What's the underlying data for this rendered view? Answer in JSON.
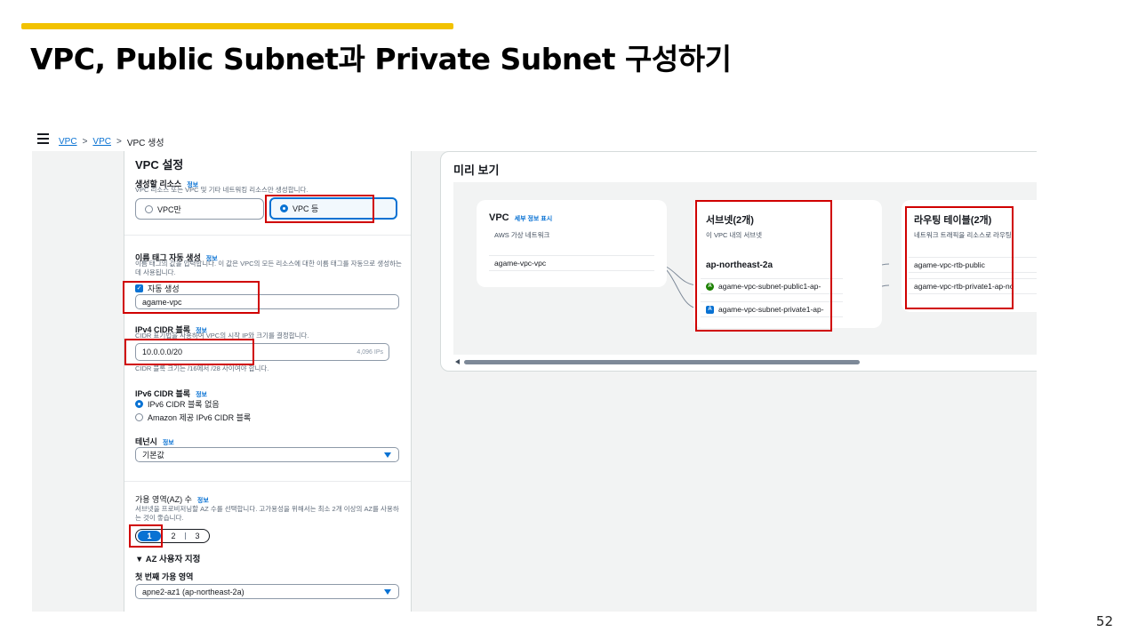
{
  "slide": {
    "title": "VPC, Public Subnet과 Private Subnet 구성하기",
    "page_number": "52",
    "accent_color": "#f2c200"
  },
  "console": {
    "breadcrumb": [
      "VPC",
      "VPC",
      "VPC 생성"
    ],
    "vpc_settings": {
      "heading": "VPC 설정",
      "resources_label": "생성할 리소스",
      "info": "정보",
      "resources_desc": "VPC 리소스 또는 VPC 및 기타 네트워킹 리소스만 생성합니다.",
      "option_vpc_only": "VPC만",
      "option_vpc_more": "VPC 등",
      "selected_option": "VPC 등"
    },
    "name_tag": {
      "label": "이름 태그 자동 생성",
      "info": "정보",
      "desc": "이름 태그의 값을 입력합니다. 이 값은 VPC의 모든 리소스에 대한 이름 태그를 자동으로 생성하는 데 사용됩니다.",
      "auto_generate_label": "자동 생성",
      "auto_generate_checked": true,
      "value": "agame-vpc"
    },
    "ipv4": {
      "label": "IPv4 CIDR 블록",
      "info": "정보",
      "desc": "CIDR 표기법을 사용하여 VPC의 시작 IP와 크기를 결정합니다.",
      "value": "10.0.0.0/20",
      "ip_count": "4,096 IPs",
      "hint": "CIDR 블록 크기는 /16에서 /28 사이여야 합니다."
    },
    "ipv6": {
      "label": "IPv6 CIDR 블록",
      "info": "정보",
      "options": [
        "IPv6 CIDR 블록 없음",
        "Amazon 제공 IPv6 CIDR 블록"
      ],
      "selected": "IPv6 CIDR 블록 없음"
    },
    "tenancy": {
      "label": "테넌시",
      "info": "정보",
      "value": "기본값"
    },
    "az": {
      "label": "가용 영역(AZ) 수",
      "info": "정보",
      "desc": "서브넷을 프로비저닝할 AZ 수를 선택합니다. 고가용성을 위해서는 최소 2개 이상의 AZ를 사용하는 것이 좋습니다.",
      "options": [
        "1",
        "2",
        "3"
      ],
      "selected": "1",
      "customize_label": "AZ 사용자 지정",
      "first_az_label": "첫 번째 가용 영역",
      "first_az_value": "apne2-az1 (ap-northeast-2a)"
    },
    "preview": {
      "title": "미리 보기",
      "vpc": {
        "title": "VPC",
        "detail_link": "세부 정보 표시",
        "subtitle": "AWS 가상 네트워크",
        "item": "agame-vpc-vpc"
      },
      "subnets": {
        "title": "서브넷(2개)",
        "subtitle": "이 VPC 내의 서브넷",
        "az_name": "ap-northeast-2a",
        "items": [
          {
            "badge": "A",
            "name": "agame-vpc-subnet-public1-ap-"
          },
          {
            "badge": "A",
            "name": "agame-vpc-subnet-private1-ap-"
          }
        ]
      },
      "route_tables": {
        "title": "라우팅 테이블(2개)",
        "subtitle": "네트워크 트래픽을 리소스로 라우팅",
        "items": [
          "agame-vpc-rtb-public",
          "agame-vpc-rtb-private1-ap-no"
        ]
      }
    }
  },
  "colors": {
    "link": "#0972d3",
    "highlight": "#d00000",
    "public_badge": "#1d8102",
    "private_badge": "#0972d3"
  }
}
